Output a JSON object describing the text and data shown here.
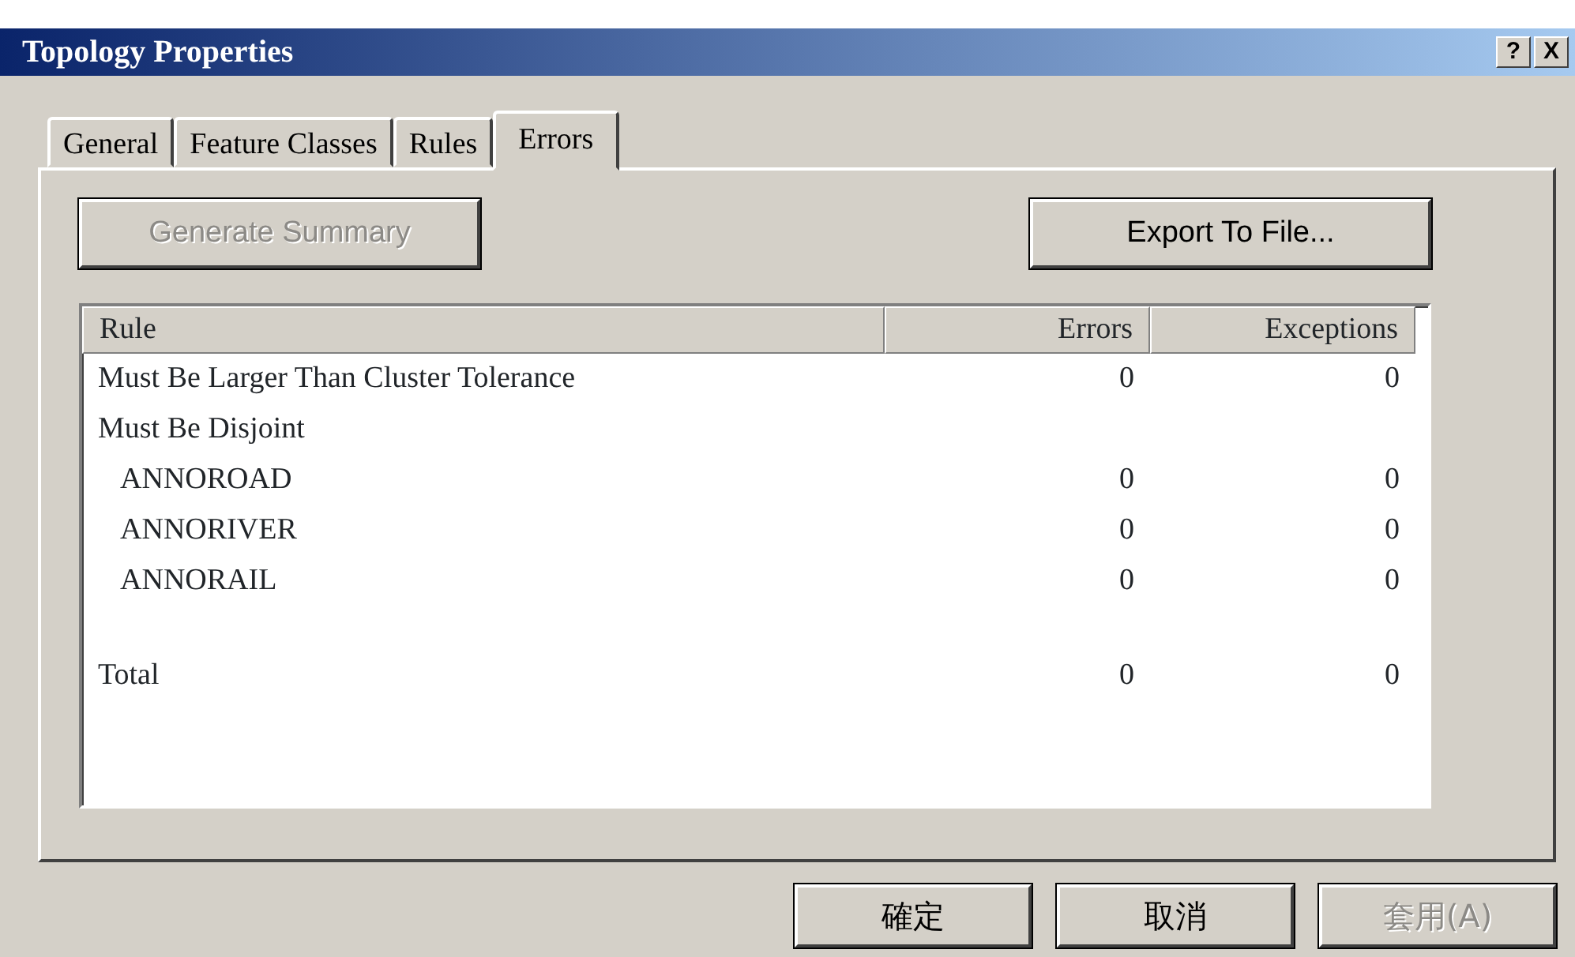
{
  "window": {
    "title": "Topology Properties",
    "help": "?",
    "close": "X"
  },
  "tabs": [
    {
      "label": "General",
      "selected": false
    },
    {
      "label": "Feature Classes",
      "selected": false
    },
    {
      "label": "Rules",
      "selected": false
    },
    {
      "label": "Errors",
      "selected": true
    }
  ],
  "toolbar": [
    {
      "label": "Generate Summary",
      "disabled": true
    },
    {
      "label": "Export To File...",
      "disabled": false
    }
  ],
  "table": {
    "columns": [
      "Rule",
      "Errors",
      "Exceptions"
    ],
    "rows": [
      {
        "rule": "Must Be Larger Than Cluster Tolerance",
        "errors": "0",
        "exceptions": "0"
      },
      {
        "rule": "Must Be Disjoint",
        "children": [
          {
            "rule": "ANNOROAD",
            "errors": "0",
            "exceptions": "0"
          },
          {
            "rule": "ANNORIVER",
            "errors": "0",
            "exceptions": "0"
          },
          {
            "rule": "ANNORAIL",
            "errors": "0",
            "exceptions": "0"
          }
        ]
      }
    ],
    "total": {
      "rule": "Total",
      "errors": "0",
      "exceptions": "0"
    }
  },
  "buttons": [
    {
      "label": "確定",
      "disabled": false
    },
    {
      "label": "取消",
      "disabled": false
    },
    {
      "label": "套用(A)",
      "disabled": true
    }
  ]
}
